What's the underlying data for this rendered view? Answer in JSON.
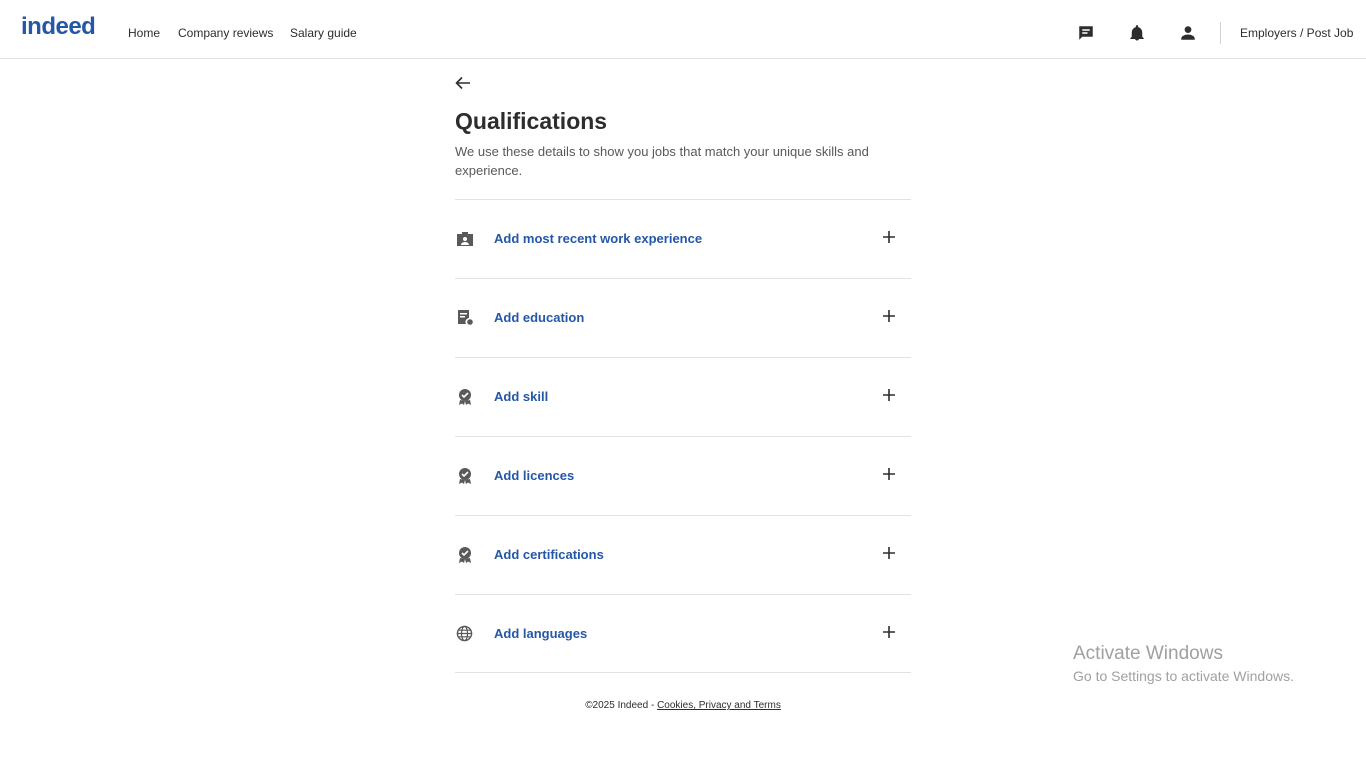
{
  "header": {
    "logo": "indeed",
    "nav": [
      {
        "label": "Home"
      },
      {
        "label": "Company reviews"
      },
      {
        "label": "Salary guide"
      }
    ],
    "icons": [
      "messages-icon",
      "notifications-icon",
      "profile-icon"
    ],
    "employers_link": "Employers / Post Job"
  },
  "page": {
    "title": "Qualifications",
    "subtitle": "We use these details to show you jobs that match your unique skills and experience."
  },
  "items": [
    {
      "label": "Add most recent work experience",
      "icon": "work-experience-icon"
    },
    {
      "label": "Add education",
      "icon": "education-icon"
    },
    {
      "label": "Add skill",
      "icon": "skill-badge-icon"
    },
    {
      "label": "Add licences",
      "icon": "licence-badge-icon"
    },
    {
      "label": "Add certifications",
      "icon": "certification-badge-icon"
    },
    {
      "label": "Add languages",
      "icon": "globe-icon"
    }
  ],
  "footer": {
    "copyright": "©2025 Indeed - ",
    "link": "Cookies, Privacy and Terms"
  },
  "watermark": {
    "line1": "Activate Windows",
    "line2": "Go to Settings to activate Windows."
  },
  "colors": {
    "brand": "#2557a7",
    "text": "#2d2d2d",
    "icon": "#595959"
  }
}
